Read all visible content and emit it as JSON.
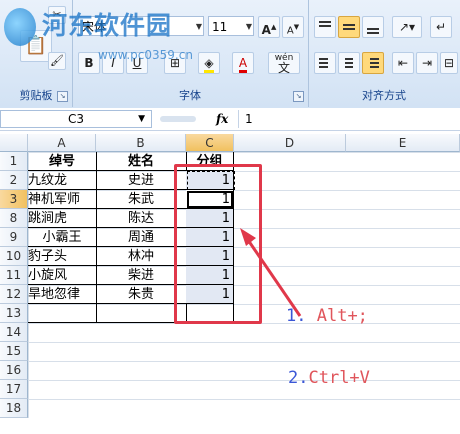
{
  "ribbon": {
    "font_name": "宋体",
    "font_size": "11",
    "grow_font": "A",
    "shrink_font": "A",
    "bold": "B",
    "italic": "I",
    "underline": "U",
    "phonetic": "wén",
    "phonetic_char": "文",
    "groups": {
      "clipboard": "剪贴板",
      "font": "字体",
      "alignment": "对齐方式"
    }
  },
  "watermark": {
    "title": "河东软件园",
    "url": "www.pc0359.cn"
  },
  "formula_bar": {
    "name_box": "C3",
    "fx": "fx",
    "value": "1"
  },
  "columns": [
    "A",
    "B",
    "C",
    "D",
    "E"
  ],
  "rows": [
    "1",
    "2",
    "3",
    "8",
    "9",
    "10",
    "11",
    "12",
    "13",
    "14",
    "15",
    "16",
    "17",
    "18"
  ],
  "table": {
    "header": [
      "绰号",
      "姓名",
      "分组"
    ],
    "data": [
      [
        "九纹龙",
        "史进",
        "1"
      ],
      [
        "神机军师",
        "朱武",
        "1"
      ],
      [
        "跳涧虎",
        "陈达",
        "1"
      ],
      [
        "小霸王",
        "周通",
        "1"
      ],
      [
        "豹子头",
        "林冲",
        "1"
      ],
      [
        "小旋风",
        "柴进",
        "1"
      ],
      [
        "旱地忽律",
        "朱贵",
        "1"
      ]
    ]
  },
  "annotations": {
    "step1_num": "1.",
    "step1_text": "Alt+;",
    "step2_num": "2.",
    "step2_text": "Ctrl+V"
  },
  "colors": {
    "highlight_box": "#e0384a",
    "annotation_blue": "#3b57d6",
    "annotation_red": "#e0555b"
  }
}
